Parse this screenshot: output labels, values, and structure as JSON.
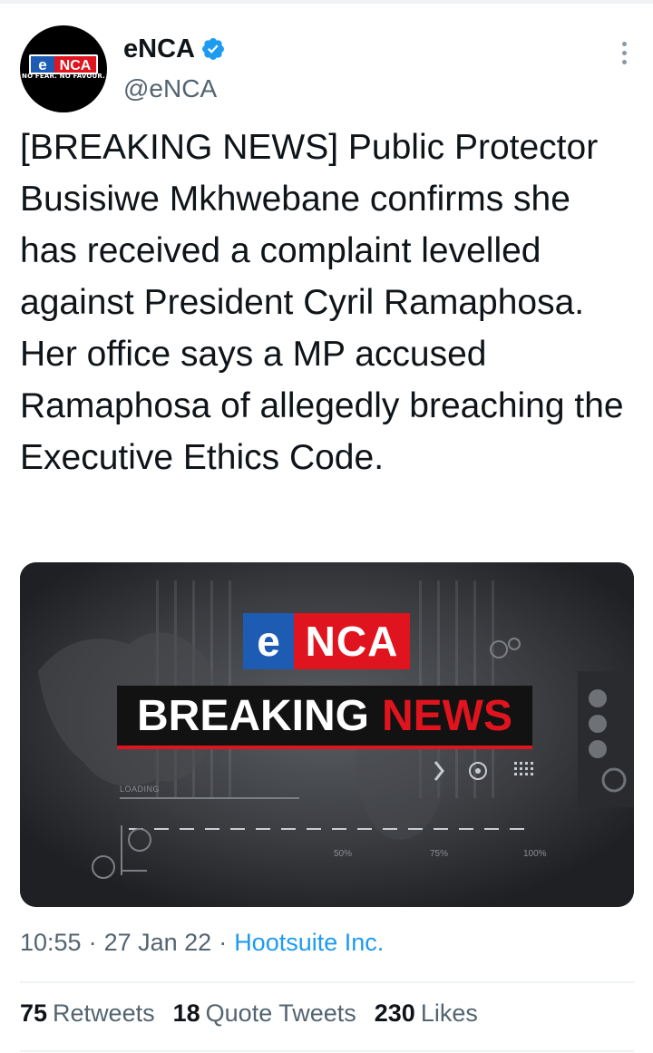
{
  "account": {
    "display_name": "eNCA",
    "handle": "@eNCA",
    "avatar_logo_e": "e",
    "avatar_logo_nca": "NCA",
    "avatar_tagline": "NO FEAR. NO FAVOUR."
  },
  "tweet": {
    "text": "[BREAKING NEWS] Public Protector Busisiwe Mkhwebane confirms she has received a complaint levelled against President Cyril Ramaphosa. Her office says a MP accused Ramaphosa of allegedly breaching the Executive Ethics Code.",
    "time": "10:55",
    "date": "27 Jan 22",
    "source": "Hootsuite Inc.",
    "separator": "·"
  },
  "media": {
    "brand_e": "e",
    "brand_nca": "NCA",
    "headline_1": "BREAKING",
    "headline_2": "NEWS",
    "loading_label": "LOADING",
    "pct_50": "50%",
    "pct_75": "75%",
    "pct_100": "100%"
  },
  "stats": [
    {
      "count": "75",
      "label": "Retweets"
    },
    {
      "count": "18",
      "label": "Quote Tweets"
    },
    {
      "count": "230",
      "label": "Likes"
    }
  ],
  "colors": {
    "verified_blue": "#1d9bf0",
    "enca_red": "#e0141e",
    "enca_blue": "#1e5cb4",
    "muted_text": "#536471"
  },
  "icons": {
    "verified": "verified-badge-icon",
    "more": "more-options-icon"
  }
}
